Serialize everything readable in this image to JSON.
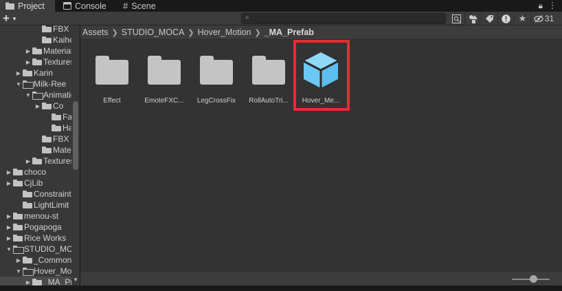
{
  "tabs": [
    {
      "label": "Project",
      "icon": "folder-icon"
    },
    {
      "label": "Console",
      "icon": "console-icon"
    },
    {
      "label": "Scene",
      "icon": "grid-icon"
    }
  ],
  "toolbar": {
    "add_label": "+",
    "search_placeholder": "",
    "hidden_count": "31"
  },
  "tree": [
    {
      "label": "FBX",
      "indent": 4,
      "arrow": "none",
      "open": false
    },
    {
      "label": "Kaihen",
      "indent": 4,
      "arrow": "none",
      "open": false
    },
    {
      "label": "Materials",
      "indent": 3,
      "arrow": "right",
      "open": false
    },
    {
      "label": "Textures",
      "indent": 3,
      "arrow": "right",
      "open": false
    },
    {
      "label": "Karin",
      "indent": 2,
      "arrow": "right",
      "open": false
    },
    {
      "label": "Milk-Ree",
      "indent": 2,
      "arrow": "down",
      "open": true
    },
    {
      "label": "Animation",
      "indent": 3,
      "arrow": "down",
      "open": true
    },
    {
      "label": "Co",
      "indent": 4,
      "arrow": "right",
      "open": false
    },
    {
      "label": "Fa",
      "indent": 5,
      "arrow": "none",
      "open": false
    },
    {
      "label": "Ha",
      "indent": 5,
      "arrow": "none",
      "open": false
    },
    {
      "label": "FBX",
      "indent": 4,
      "arrow": "none",
      "open": false
    },
    {
      "label": "Materials",
      "indent": 4,
      "arrow": "none",
      "open": false
    },
    {
      "label": "Textures",
      "indent": 3,
      "arrow": "right",
      "open": false
    },
    {
      "label": "choco",
      "indent": 1,
      "arrow": "right",
      "open": false
    },
    {
      "label": "CjLib",
      "indent": 1,
      "arrow": "right",
      "open": false
    },
    {
      "label": "Constraint",
      "indent": 2,
      "arrow": "none",
      "open": false
    },
    {
      "label": "LightLimit",
      "indent": 2,
      "arrow": "none",
      "open": false
    },
    {
      "label": "menou-st",
      "indent": 1,
      "arrow": "right",
      "open": false
    },
    {
      "label": "Pogapoga",
      "indent": 1,
      "arrow": "right",
      "open": false
    },
    {
      "label": "Rice Works",
      "indent": 1,
      "arrow": "right",
      "open": false
    },
    {
      "label": "STUDIO_MOCA",
      "indent": 1,
      "arrow": "down",
      "open": true
    },
    {
      "label": "_Common",
      "indent": 2,
      "arrow": "right",
      "open": false
    },
    {
      "label": "Hover_Motion",
      "indent": 2,
      "arrow": "down",
      "open": true
    },
    {
      "label": "_MA_Prefab",
      "indent": 3,
      "arrow": "right",
      "open": false,
      "selected": true
    }
  ],
  "breadcrumb": [
    "Assets",
    "STUDIO_MOCA",
    "Hover_Motion",
    "_MA_Prefab"
  ],
  "assets": [
    {
      "label": "Effect",
      "type": "folder"
    },
    {
      "label": "EmoteFXC...",
      "type": "folder"
    },
    {
      "label": "LegCrossFix",
      "type": "folder"
    },
    {
      "label": "RollAutoTri...",
      "type": "folder"
    },
    {
      "label": "Hover_Me...",
      "type": "prefab",
      "highlighted": true
    }
  ],
  "colors": {
    "highlight": "#ee2a33",
    "prefab": "#6cc8f4",
    "prefab_dark": "#3a94c8"
  },
  "zoom_slider": 0.5
}
